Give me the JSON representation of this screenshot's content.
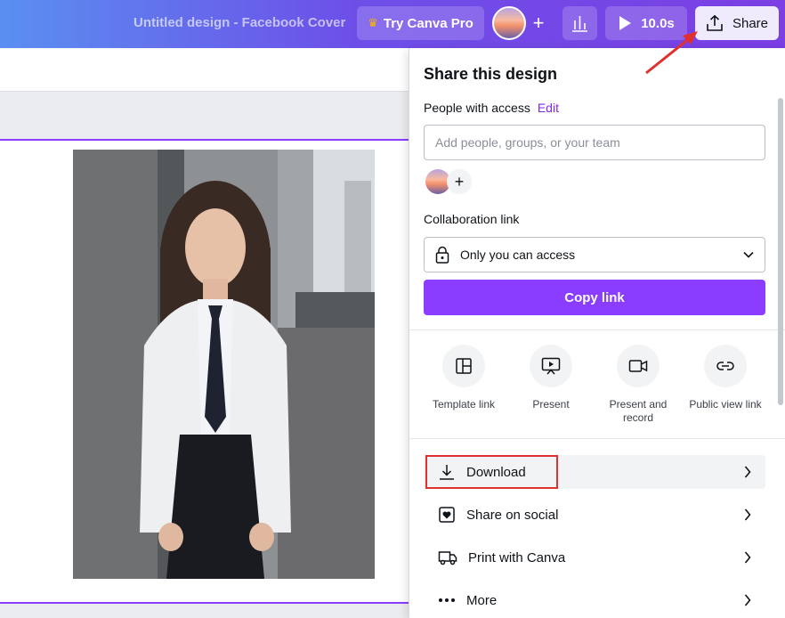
{
  "header": {
    "doc_title": "Untitled design - Facebook Cover",
    "try_pro_label": "Try Canva Pro",
    "timer_label": "10.0s",
    "share_label": "Share"
  },
  "share_panel": {
    "title": "Share this design",
    "people_access_label": "People with access",
    "edit_label": "Edit",
    "people_placeholder": "Add people, groups, or your team",
    "collab_label": "Collaboration link",
    "collab_value": "Only you can access",
    "copy_link_label": "Copy link",
    "options": [
      {
        "label": "Template link",
        "icon": "template-icon"
      },
      {
        "label": "Present",
        "icon": "present-icon"
      },
      {
        "label": "Present and record",
        "icon": "record-icon"
      },
      {
        "label": "Public view link",
        "icon": "link-icon"
      }
    ],
    "rows": [
      {
        "label": "Download",
        "icon": "download-icon"
      },
      {
        "label": "Share on social",
        "icon": "heart-icon"
      },
      {
        "label": "Print with Canva",
        "icon": "truck-icon"
      },
      {
        "label": "More",
        "icon": "more-icon"
      }
    ]
  },
  "colors": {
    "brand_purple": "#8b3dff",
    "annotation_red": "#e03131"
  }
}
